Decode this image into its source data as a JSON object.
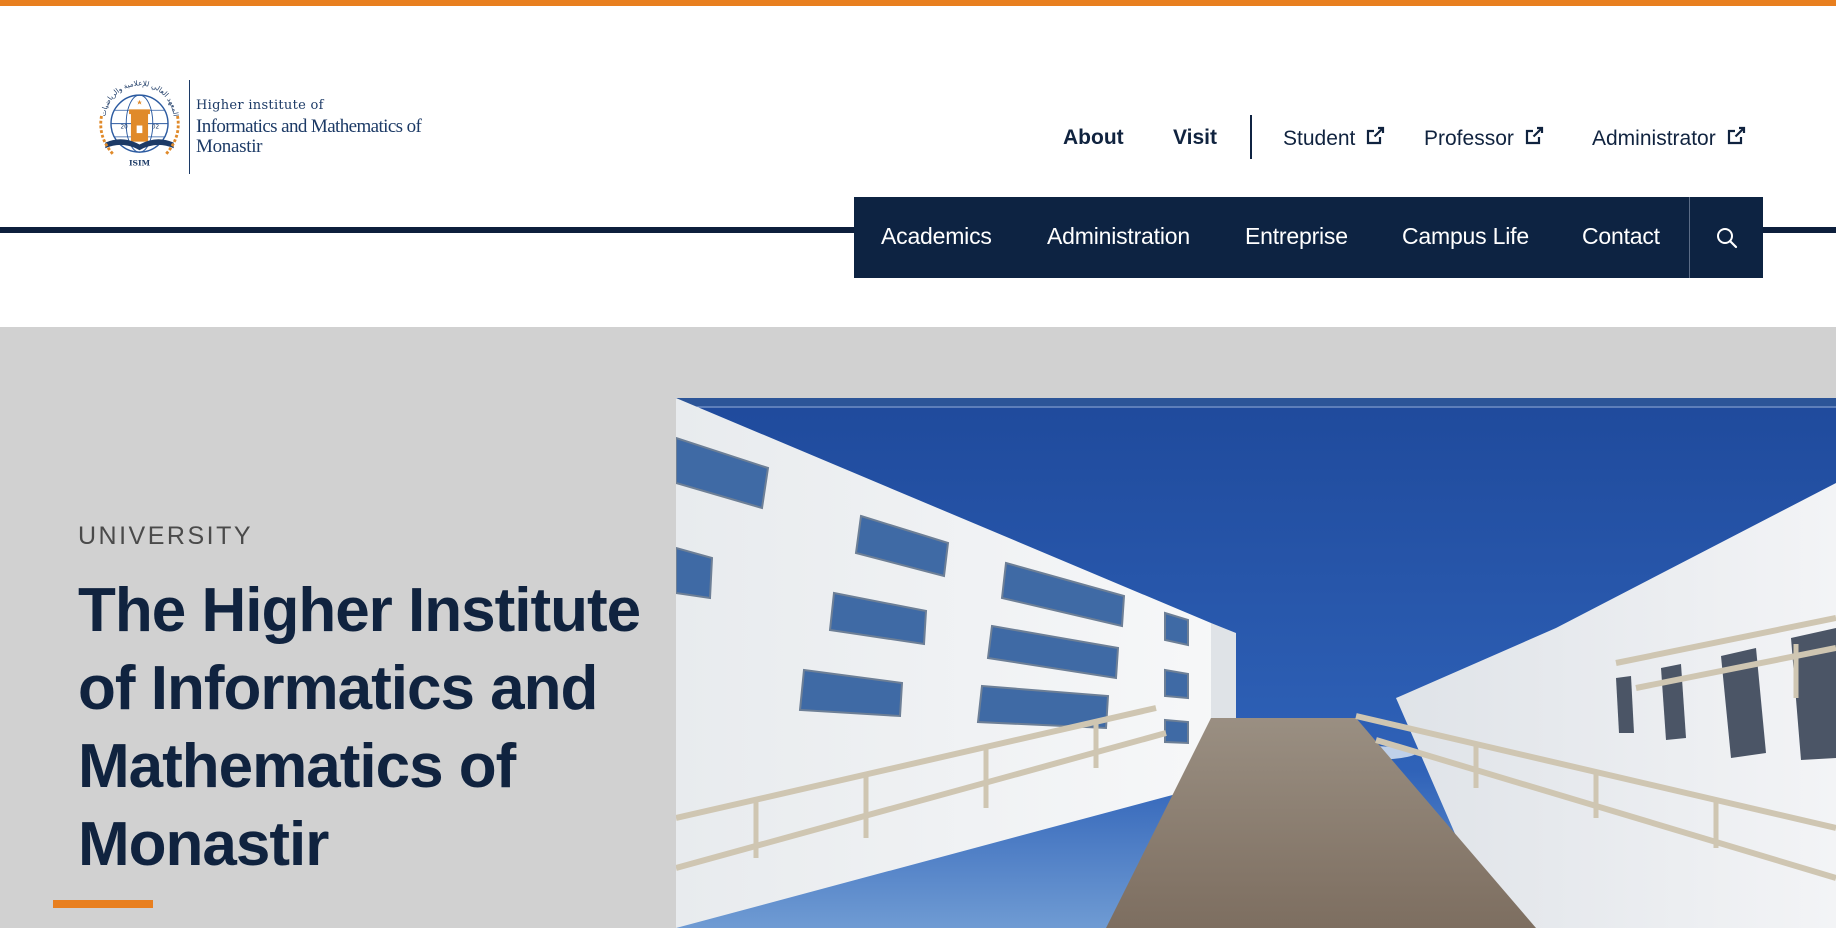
{
  "colors": {
    "accent": "#e87f1f",
    "navy": "#0d2342",
    "hero_bg": "#d1d1d1"
  },
  "logo": {
    "arabic_arc": "المعهد العالي للإعلامية والرياضيات",
    "emblem_text": "ISIM",
    "year_left": "20",
    "year_right": "02",
    "line1": "Higher institute of",
    "line2": "Informatics and Mathematics of",
    "line3": "Monastir"
  },
  "utility_nav": {
    "about": "About",
    "visit": "Visit",
    "student": "Student",
    "professor": "Professor",
    "administrator": "Administrator",
    "external_icon": "external-link-icon"
  },
  "main_nav": {
    "items": [
      "Academics",
      "Administration",
      "Entreprise",
      "Campus Life",
      "Contact"
    ],
    "search_icon": "search-icon"
  },
  "hero": {
    "eyebrow": "UNIVERSITY",
    "title": "The Higher Institute of Informatics and Mathematics of Monastir"
  }
}
